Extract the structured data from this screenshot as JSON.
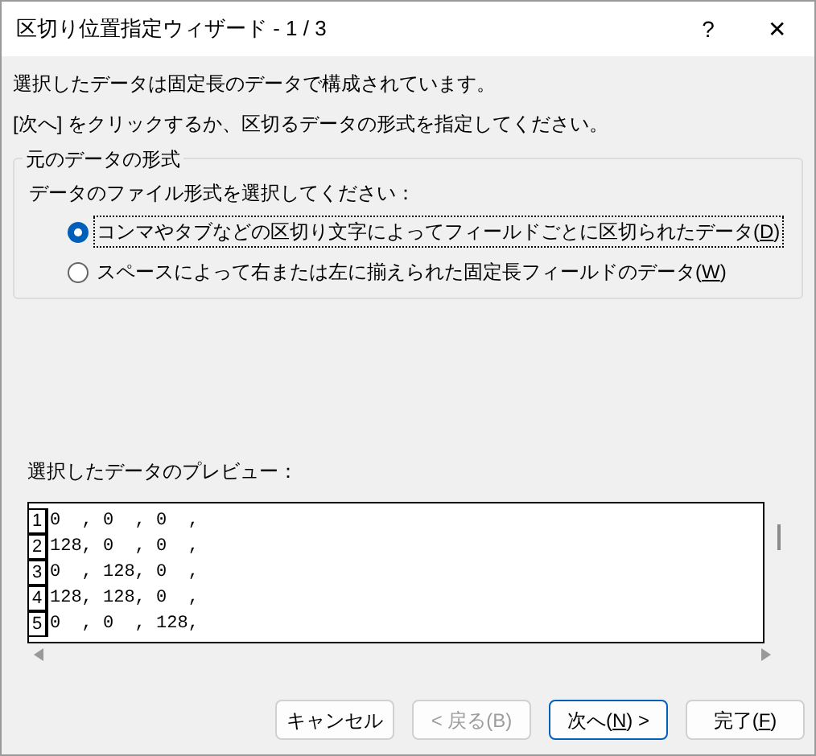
{
  "window": {
    "title": "区切り位置指定ウィザード - 1 / 3",
    "help": "?",
    "close": "✕"
  },
  "intro": [
    "選択したデータは固定長のデータで構成されています。",
    "[次へ] をクリックするか、区切るデータの形式を指定してください。"
  ],
  "group": {
    "title": "元のデータの形式",
    "prompt": "データのファイル形式を選択してください：",
    "options": [
      {
        "before": "コンマやタブなどの区切り文字によってフィールドごとに区切られたデータ(",
        "key": "D",
        "after": ")",
        "selected": true
      },
      {
        "before": "スペースによって右または左に揃えられた固定長フィールドのデータ(",
        "key": "W",
        "after": ")",
        "selected": false
      }
    ]
  },
  "preview": {
    "label": "選択したデータのプレビュー：",
    "rows": [
      {
        "number": "1",
        "text": "0  , 0  , 0  ,"
      },
      {
        "number": "2",
        "text": "128, 0  , 0  ,"
      },
      {
        "number": "3",
        "text": "0  , 128, 0  ,"
      },
      {
        "number": "4",
        "text": "128, 128, 0  ,"
      },
      {
        "number": "5",
        "text": "0  , 0  , 128,"
      }
    ]
  },
  "buttons": [
    {
      "before": "キャンセル",
      "disabled": false,
      "default": false
    },
    {
      "before": "< 戻る(B)",
      "disabled": true,
      "default": false
    },
    {
      "before": "次へ(",
      "key": "N",
      "after": ") >",
      "disabled": false,
      "default": true
    },
    {
      "before": "完了(",
      "key": "F",
      "after": ")",
      "disabled": false,
      "default": false
    }
  ]
}
